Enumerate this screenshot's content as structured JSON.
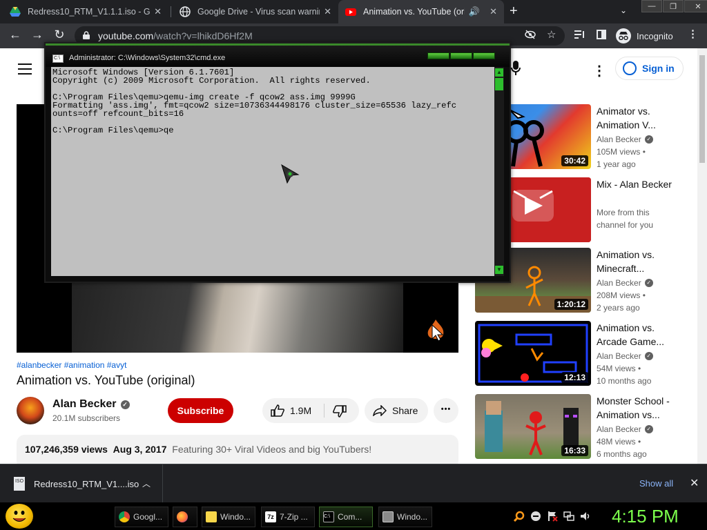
{
  "browser": {
    "tabs": [
      {
        "title": "Redress10_RTM_V1.1.1.iso - Goog",
        "icon": "google-drive-icon"
      },
      {
        "title": "Google Drive - Virus scan warnin",
        "icon": "globe-icon"
      },
      {
        "title": "Animation vs. YouTube (origi",
        "icon": "youtube-icon"
      }
    ],
    "new_tab": "+",
    "url_host": "youtube.com",
    "url_path": "/watch?v=lhikdD6Hf2M",
    "profile_label": "Incognito"
  },
  "youtube": {
    "sign_in": "Sign in",
    "tags": "#alanbecker #animation #avyt",
    "title": "Animation vs. YouTube (original)",
    "channel": "Alan Becker",
    "subscribers": "20.1M subscribers",
    "subscribe": "Subscribe",
    "likes": "1.9M",
    "share": "Share",
    "more": "•••",
    "views": "107,246,359 views",
    "date": "Aug 3, 2017",
    "description": "Featuring 30+ Viral Videos and big YouTubers!",
    "recommendations": [
      {
        "title": "Animator vs. Animation V...",
        "channel": "Alan Becker",
        "views": "105M views •",
        "age": "1 year ago",
        "duration": "30:42",
        "verified": true
      },
      {
        "title": "Mix - Alan Becker",
        "channel": "More from this",
        "views": "channel for you",
        "age": "",
        "duration": "",
        "verified": false
      },
      {
        "title": "Animation vs. Minecraft...",
        "channel": "Alan Becker",
        "views": "208M views •",
        "age": "2 years ago",
        "duration": "1:20:12",
        "verified": true
      },
      {
        "title": "Animation vs. Arcade Game...",
        "channel": "Alan Becker",
        "views": "54M views •",
        "age": "10 months ago",
        "duration": "12:13",
        "verified": true
      },
      {
        "title": "Monster School - Animation vs...",
        "channel": "Alan Becker",
        "views": "48M views •",
        "age": "6 months ago",
        "duration": "16:33",
        "verified": true
      }
    ]
  },
  "cmd": {
    "title": "Administrator: C:\\Windows\\System32\\cmd.exe",
    "text": "Microsoft Windows [Version 6.1.7601]\nCopyright (c) 2009 Microsoft Corporation.  All rights reserved.\n\nC:\\Program Files\\qemu>qemu-img create -f qcow2 ass.img 9999G\nFormatting 'ass.img', fmt=qcow2 size=10736344498176 cluster_size=65536 lazy_refc\nounts=off refcount_bits=16\n\nC:\\Program Files\\qemu>qe"
  },
  "downloads": {
    "file_name": "Redress10_RTM_V1....iso",
    "file_ext": "ISO",
    "show_all": "Show all"
  },
  "taskbar": {
    "items": [
      {
        "label": "Googl...",
        "icon": "chrome-icon"
      },
      {
        "label": "",
        "icon": "firefox-icon"
      },
      {
        "label": "Windo...",
        "icon": "folder-icon"
      },
      {
        "label": "7-Zip ...",
        "icon": "7zip-icon"
      },
      {
        "label": "Com...",
        "icon": "cmd-icon"
      },
      {
        "label": "Windo...",
        "icon": "window-icon"
      }
    ],
    "clock": "4:15 PM"
  },
  "colors": {
    "youtube_red": "#cc0000",
    "link_blue": "#065fd4",
    "clock_green": "#7cff4c"
  }
}
